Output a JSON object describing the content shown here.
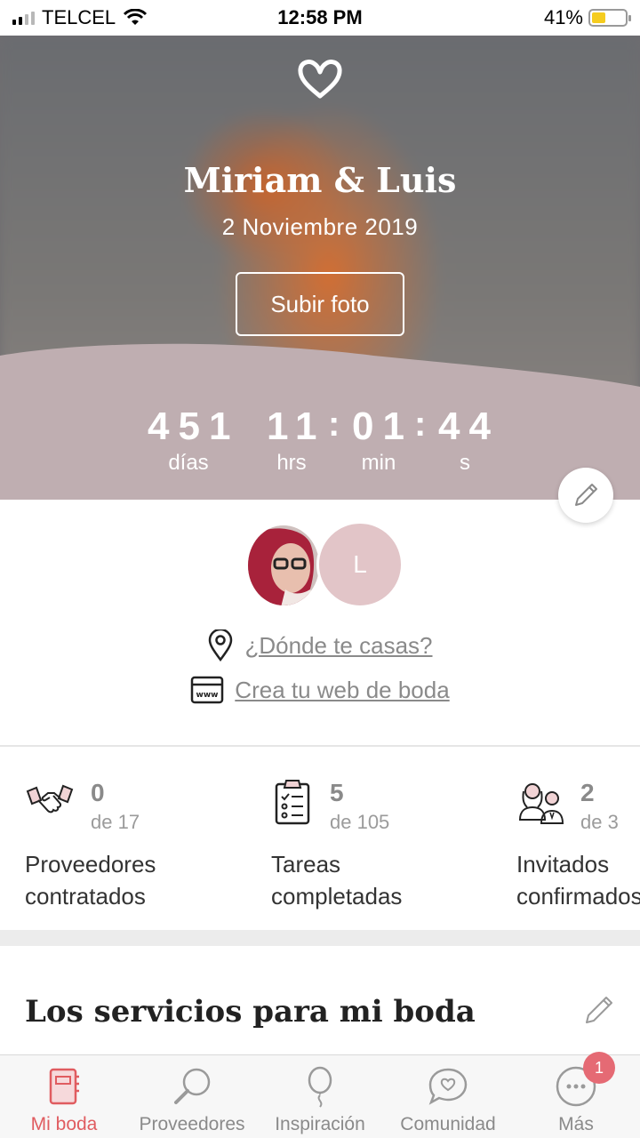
{
  "status_bar": {
    "carrier": "TELCEL",
    "time": "12:58 PM",
    "battery_percent": "41%",
    "battery_level": 0.41,
    "signal_bars_active": 2
  },
  "hero": {
    "logo_icon": "heart-icon",
    "couple_names": "Miriam & Luis",
    "wedding_date": "2 Noviembre 2019",
    "upload_button": "Subir foto",
    "countdown": {
      "days": "451",
      "days_label": "días",
      "hours": "11",
      "hours_label": "hrs",
      "minutes": "01",
      "minutes_label": "min",
      "seconds": "44",
      "seconds_label": "s",
      "separator": ":"
    }
  },
  "avatars": {
    "partner_initial": "L"
  },
  "links": {
    "location": "¿Dónde te casas?",
    "website": "Crea tu web de boda"
  },
  "stats": [
    {
      "icon": "handshake-icon",
      "count": "0",
      "total": "de 17",
      "label_line1": "Proveedores",
      "label_line2": "contratados"
    },
    {
      "icon": "checklist-icon",
      "count": "5",
      "total": "de 105",
      "label_line1": "Tareas",
      "label_line2": "completadas"
    },
    {
      "icon": "guests-icon",
      "count": "2",
      "total": "de 3",
      "label_line1": "Invitados",
      "label_line2": "confirmados"
    }
  ],
  "section": {
    "title": "Los servicios para mi boda"
  },
  "tabbar": {
    "tabs": [
      {
        "label": "Mi boda",
        "icon": "notebook-icon",
        "active": true
      },
      {
        "label": "Proveedores",
        "icon": "magnifier-icon",
        "active": false
      },
      {
        "label": "Inspiración",
        "icon": "balloon-icon",
        "active": false
      },
      {
        "label": "Comunidad",
        "icon": "chat-heart-icon",
        "active": false
      },
      {
        "label": "Más",
        "icon": "more-icon",
        "active": false
      }
    ],
    "more_badge": "1"
  },
  "colors": {
    "accent": "#e05c60",
    "wave": "#bfaeb1",
    "avatar_letter_bg": "#e2c5c8",
    "badge": "#e56a74"
  }
}
